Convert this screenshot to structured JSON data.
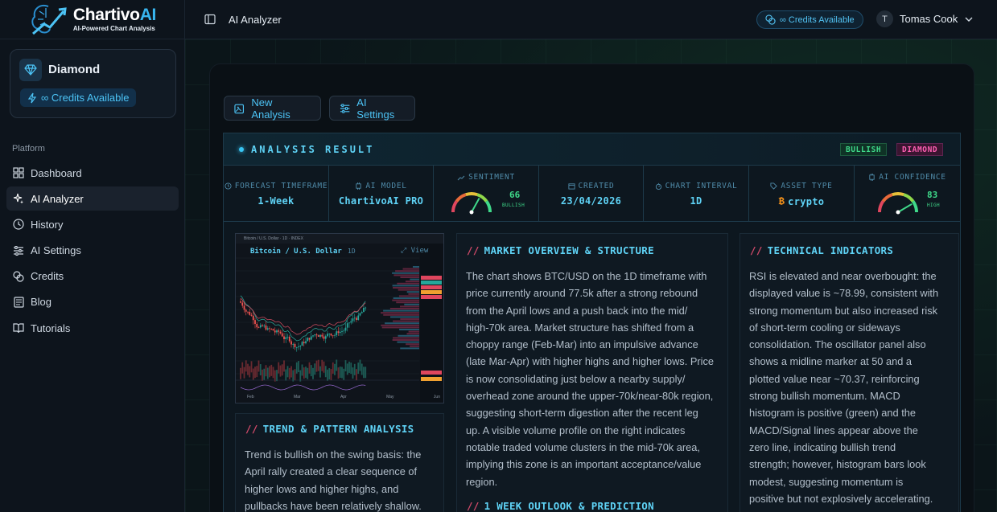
{
  "brand": {
    "name": "Chartivo",
    "name_ai": "AI",
    "tagline": "AI-Powered Chart Analysis"
  },
  "plan": {
    "name": "Diamond",
    "credits": "∞ Credits Available"
  },
  "nav": {
    "section": "Platform",
    "items": [
      {
        "label": "Dashboard",
        "icon": "dashboard-icon"
      },
      {
        "label": "AI Analyzer",
        "icon": "sparkle-icon",
        "active": true
      },
      {
        "label": "History",
        "icon": "clock-icon"
      },
      {
        "label": "AI Settings",
        "icon": "sliders-icon"
      },
      {
        "label": "Credits",
        "icon": "coins-icon"
      },
      {
        "label": "Blog",
        "icon": "newspaper-icon"
      },
      {
        "label": "Tutorials",
        "icon": "book-icon"
      }
    ]
  },
  "topbar": {
    "title": "AI Analyzer",
    "credits": "∞ Credits Available",
    "user_initial": "T",
    "user_name": "Tomas Cook"
  },
  "actions": {
    "new_analysis": "New Analysis",
    "ai_settings": "AI Settings"
  },
  "result": {
    "title": "ANALYSIS RESULT",
    "badges": {
      "trend": "BULLISH",
      "plan": "DIAMOND"
    },
    "stats": {
      "forecast_label": "FORECAST TIMEFRAME",
      "forecast_value": "1-Week",
      "model_label": "AI MODEL",
      "model_value": "ChartivoAI PRO",
      "sentiment_label": "SENTIMENT",
      "sentiment_value": "66",
      "sentiment_sub": "BULLISH",
      "created_label": "CREATED",
      "created_value": "23/04/2026",
      "interval_label": "CHART INTERVAL",
      "interval_value": "1D",
      "asset_label": "ASSET TYPE",
      "asset_value": "crypto",
      "confidence_label": "AI CONFIDENCE",
      "confidence_value": "83",
      "confidence_sub": "HIGH"
    },
    "gauges": {
      "sentiment": 0.66,
      "confidence": 0.83
    },
    "chart": {
      "top_text": "Bitcoin / U.S. Dollar · 1D · INDEX",
      "title": "Bitcoin / U.S. Dollar",
      "interval": "1D",
      "view": "View",
      "months": [
        "Feb",
        "Mar",
        "Apr",
        "May",
        "Jun"
      ]
    },
    "trend": {
      "title": "TREND & PATTERN ANALYSIS",
      "lines": [
        "Trend is bullish on the swing basis: the",
        "April rally created a clear sequence of",
        "higher lows and higher highs, and",
        "pullbacks have been relatively shallow."
      ]
    },
    "market": {
      "title": "MARKET OVERVIEW & STRUCTURE",
      "lines": [
        "The chart shows BTC/USD on the 1D timeframe with",
        "price currently around 77.5k after a strong rebound",
        "from the April lows and a push back into the mid/",
        "high-70k area. Market structure has shifted from a",
        "choppy range (Feb-Mar) into an impulsive advance",
        "(late Mar-Apr) with higher highs and higher lows. Price",
        "is now consolidating just below a nearby supply/",
        "overhead zone around the upper-70k/near-80k region,",
        "suggesting short-term digestion after the recent leg",
        "up. A visible volume profile on the right indicates",
        "notable traded volume clusters in the mid-70k area,",
        "implying this zone is an important acceptance/value",
        "region."
      ],
      "outlook_title": "1 WEEK OUTLOOK & PREDICTION"
    },
    "tech": {
      "title": "TECHNICAL INDICATORS",
      "lines": [
        "RSI is elevated and near overbought: the",
        "displayed value is ~78.99, consistent with",
        "strong momentum but also increased risk",
        "of short-term cooling or sideways",
        "consolidation. The oscillator panel also",
        "shows a midline marker at 50 and a",
        "plotted value near ~70.37, reinforcing",
        "strong bullish momentum. MACD",
        "histogram is positive (green) and the",
        "MACD/Signal lines appear above the",
        "zero line, indicating bullish trend",
        "strength; however, histogram bars look",
        "modest, suggesting momentum is",
        "positive but not explosively accelerating."
      ]
    }
  },
  "colors": {
    "accent": "#5fd3f6",
    "bullish": "#3fd98a",
    "bearish": "#e0465e",
    "diamond": "#ff5fb3"
  }
}
